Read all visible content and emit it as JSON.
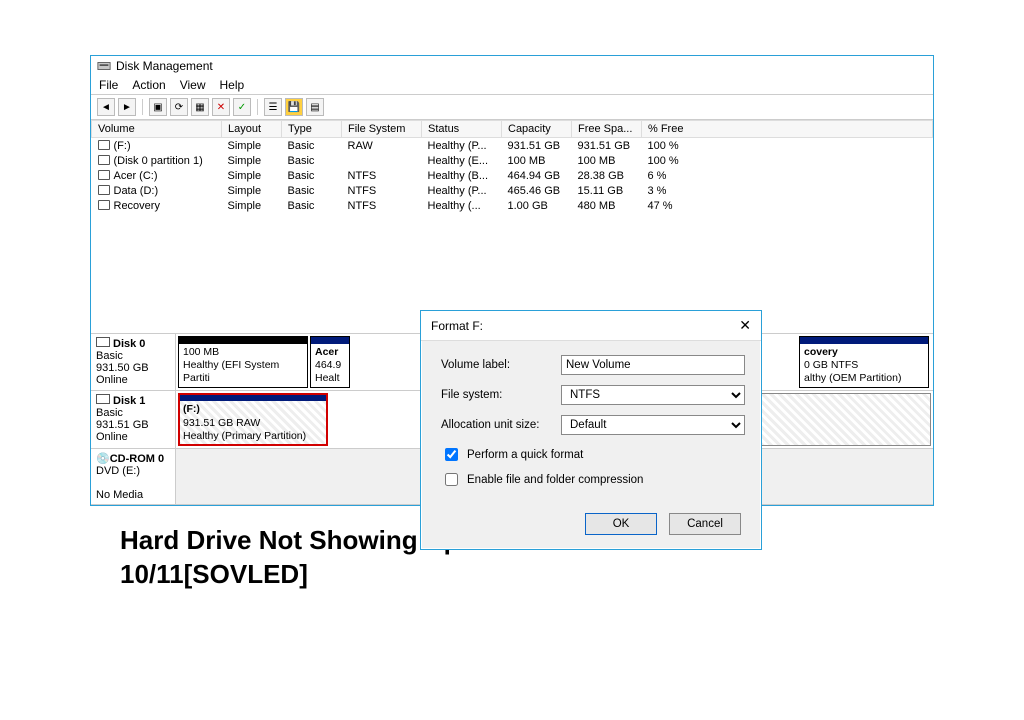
{
  "window": {
    "title": "Disk Management"
  },
  "menubar": [
    "File",
    "Action",
    "View",
    "Help"
  ],
  "columns": [
    "Volume",
    "Layout",
    "Type",
    "File System",
    "Status",
    "Capacity",
    "Free Spa...",
    "% Free"
  ],
  "volumes": [
    {
      "name": "(F:)",
      "layout": "Simple",
      "type": "Basic",
      "fs": "RAW",
      "status": "Healthy (P...",
      "cap": "931.51 GB",
      "free": "931.51 GB",
      "pct": "100 %"
    },
    {
      "name": "(Disk 0 partition 1)",
      "layout": "Simple",
      "type": "Basic",
      "fs": "",
      "status": "Healthy (E...",
      "cap": "100 MB",
      "free": "100 MB",
      "pct": "100 %"
    },
    {
      "name": "Acer (C:)",
      "layout": "Simple",
      "type": "Basic",
      "fs": "NTFS",
      "status": "Healthy (B...",
      "cap": "464.94 GB",
      "free": "28.38 GB",
      "pct": "6 %"
    },
    {
      "name": "Data (D:)",
      "layout": "Simple",
      "type": "Basic",
      "fs": "NTFS",
      "status": "Healthy (P...",
      "cap": "465.46 GB",
      "free": "15.11 GB",
      "pct": "3 %"
    },
    {
      "name": "Recovery",
      "layout": "Simple",
      "type": "Basic",
      "fs": "NTFS",
      "status": "Healthy (...",
      "cap": "1.00 GB",
      "free": "480 MB",
      "pct": "47 %"
    }
  ],
  "disks": {
    "disk0": {
      "name": "Disk 0",
      "type": "Basic",
      "size": "931.50 GB",
      "state": "Online",
      "parts": [
        {
          "title": "",
          "l2": "100 MB",
          "l3": "Healthy (EFI System Partiti"
        },
        {
          "title": "Acer",
          "l2": "464.9",
          "l3": "Healt"
        },
        {
          "title": "covery",
          "l2": "0 GB NTFS",
          "l3": "althy (OEM Partition)"
        }
      ]
    },
    "disk1": {
      "name": "Disk 1",
      "type": "Basic",
      "size": "931.51 GB",
      "state": "Online",
      "parts": [
        {
          "title": "(F:)",
          "l2": "931.51 GB RAW",
          "l3": "Healthy (Primary Partition)"
        }
      ]
    },
    "cd": {
      "name": "CD-ROM 0",
      "sub": "DVD (E:)",
      "state": "No Media"
    }
  },
  "dialog": {
    "title": "Format F:",
    "labels": {
      "vol": "Volume label:",
      "fs": "File system:",
      "au": "Allocation unit size:"
    },
    "values": {
      "vol": "New Volume",
      "fs": "NTFS",
      "au": "Default"
    },
    "chk1": "Perform a quick format",
    "chk2": "Enable file and folder compression",
    "ok": "OK",
    "cancel": "Cancel"
  },
  "headline": "Hard Drive Not Showing Up or Detected in Windows 10/11[SOVLED]"
}
